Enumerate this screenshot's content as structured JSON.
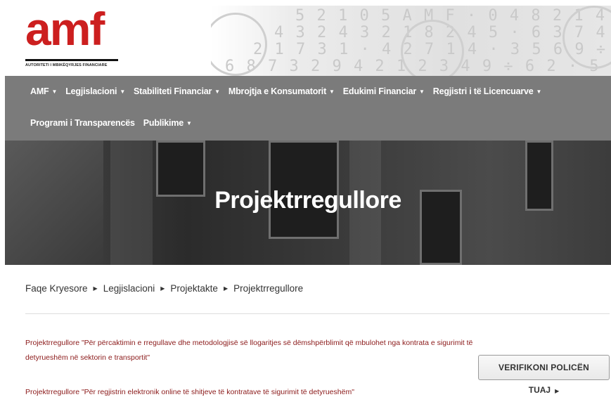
{
  "brand": {
    "logo_text": "amf",
    "logo_subtitle": "AUTORITETI I MBIKËQYRJES FINANCIARE",
    "logo_color": "#cc1f1f"
  },
  "nav": {
    "row1": [
      {
        "label": "AMF",
        "has_dropdown": true
      },
      {
        "label": "Legjislacioni",
        "has_dropdown": true
      },
      {
        "label": "Stabiliteti Financiar",
        "has_dropdown": true
      },
      {
        "label": "Mbrojtja e Konsumatorit",
        "has_dropdown": true
      },
      {
        "label": "Edukimi Financiar",
        "has_dropdown": true
      },
      {
        "label": "Regjistri i të Licencuarve",
        "has_dropdown": true
      }
    ],
    "row2": [
      {
        "label": "Programi i Transparencës",
        "has_dropdown": false
      },
      {
        "label": "Publikime",
        "has_dropdown": true
      }
    ],
    "background": "#7b7b7b"
  },
  "hero": {
    "title": "Projektrregullore"
  },
  "breadcrumb": [
    "Faqe Kryesore",
    "Legjislacioni",
    "Projektakte",
    "Projektrregullore"
  ],
  "documents": [
    {
      "text": "Projektrregullore \"Për përcaktimin e rregullave dhe metodologjisë së llogaritjes së dëmshpërblimit që mbulohet nga kontrata e sigurimit të detyrueshëm në sektorin e transportit\""
    },
    {
      "text": "Projektrregullore \"Për regjistrin elektronik online të shitjeve të kontratave të sigurimit të detyrueshëm\""
    }
  ],
  "sidebar": {
    "verify_button": "VERIFIKONI POLICËN",
    "verify_more": "TUAJ"
  },
  "colors": {
    "link": "#8b1a1a",
    "accent": "#cc1f1f"
  }
}
